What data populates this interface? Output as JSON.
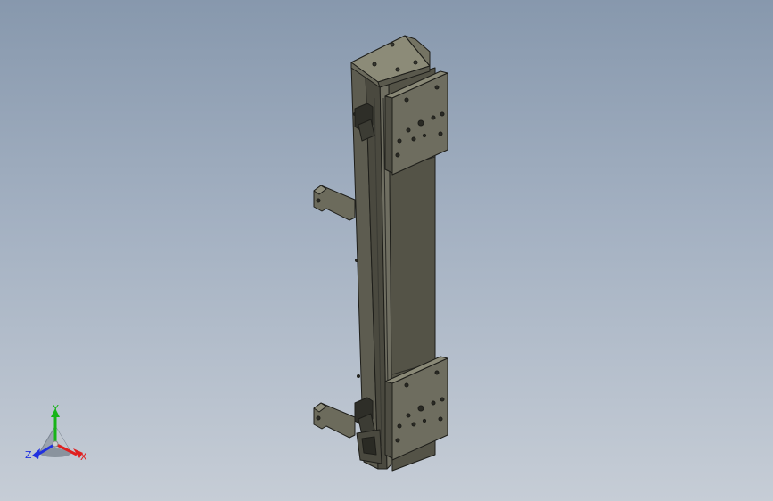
{
  "viewport": {
    "name": "cad-3d-viewport",
    "background_top": "#8798ad",
    "background_bottom": "#c6cdd6"
  },
  "model": {
    "name": "linear-actuator-assembly",
    "body_color": "#5b5a4e",
    "edge_color": "#1e1e1a"
  },
  "triad": {
    "x_label": "X",
    "y_label": "Y",
    "z_label": "Z",
    "x_color": "#e02020",
    "y_color": "#18b418",
    "z_color": "#2030e0"
  }
}
